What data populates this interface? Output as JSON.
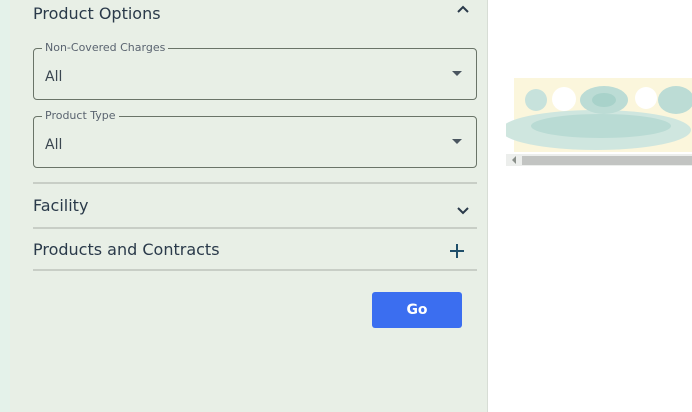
{
  "product_options": {
    "title": "Product Options",
    "non_covered_charges": {
      "label": "Non-Covered Charges",
      "value": "All"
    },
    "product_type": {
      "label": "Product Type",
      "value": "All"
    }
  },
  "accordion": {
    "facility": "Facility",
    "products_and_contracts": "Products and Contracts"
  },
  "actions": {
    "go_label": "Go"
  },
  "colors": {
    "panel_background": "#e8efe6",
    "accent_button": "#3b6ef0",
    "text_primary": "#2a3a4a"
  }
}
